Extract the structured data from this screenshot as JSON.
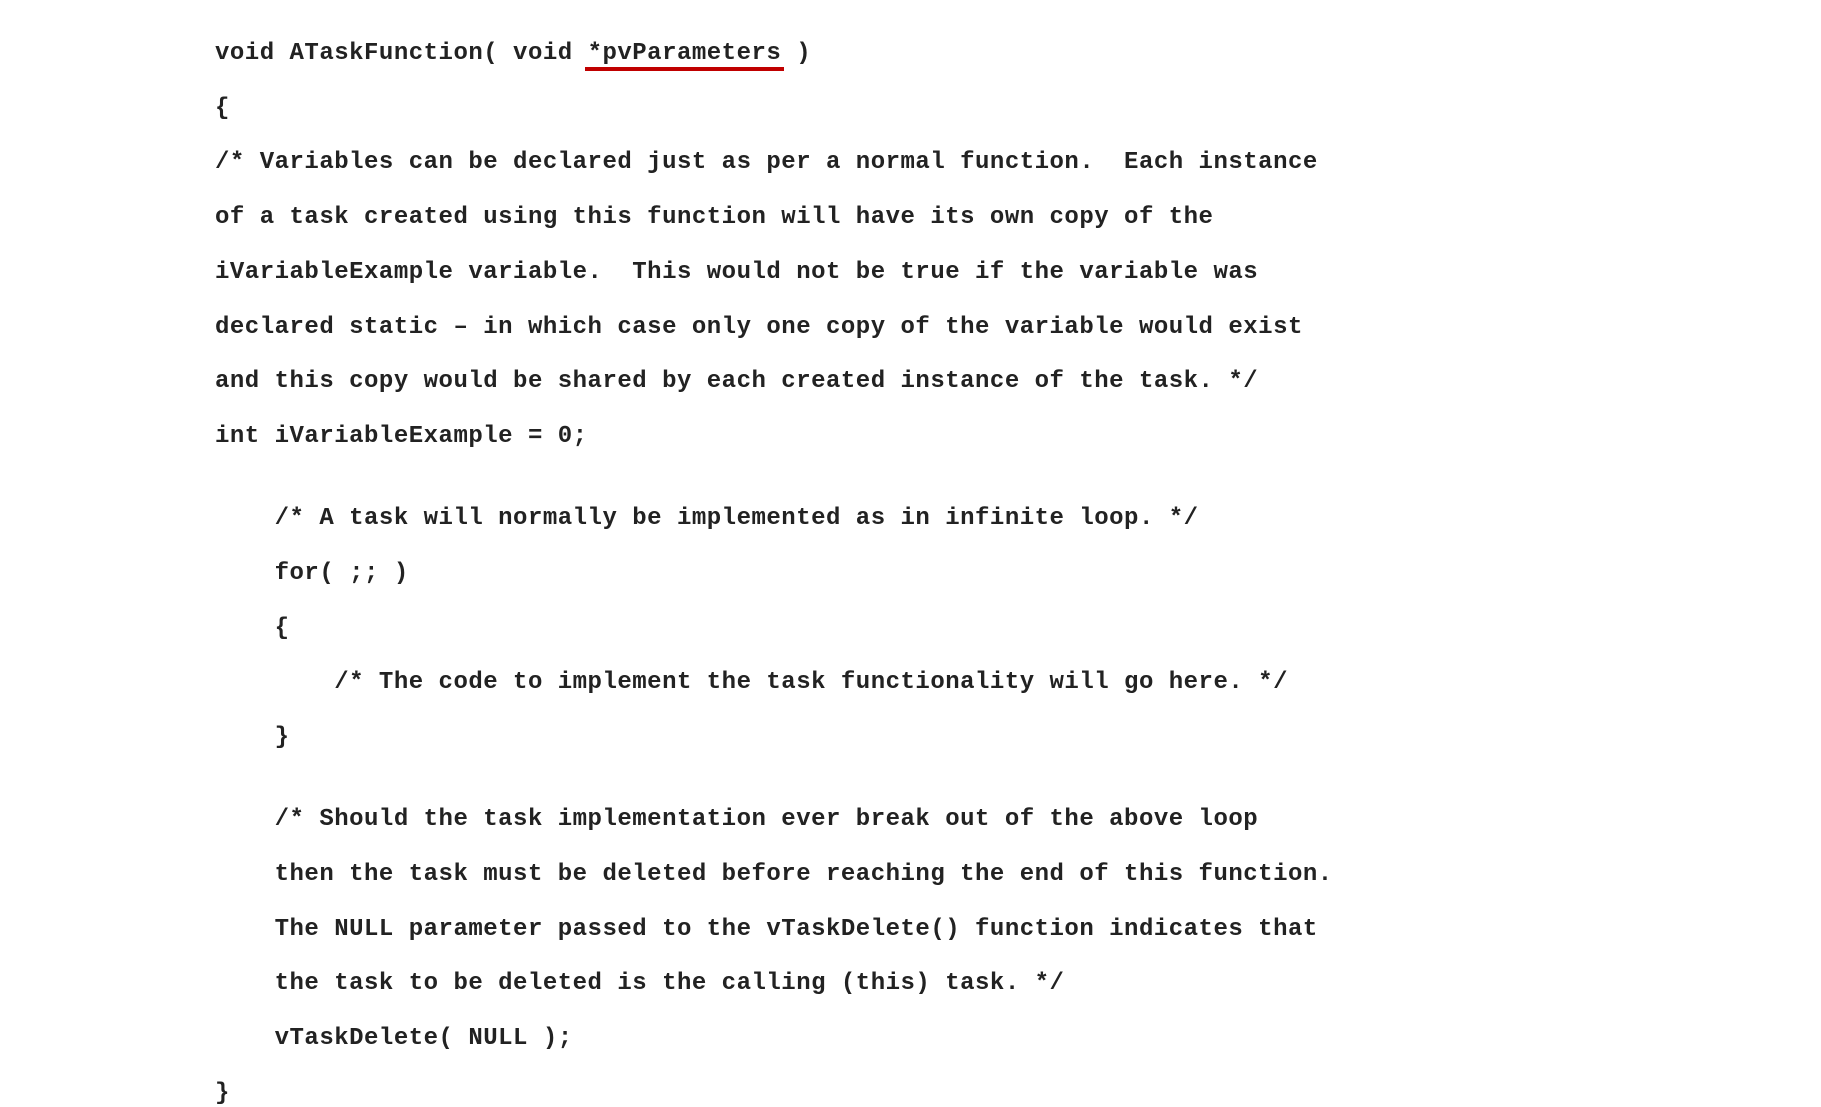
{
  "code": {
    "line01a": "void ATaskFunction( void ",
    "line01b": "*pvParameters",
    "line01c": " )",
    "line02": "{",
    "line03": "/* Variables can be declared just as per a normal function.  Each instance",
    "line04": "of a task created using this function will have its own copy of the",
    "line05": "iVariableExample variable.  This would not be true if the variable was",
    "line06": "declared static – in which case only one copy of the variable would exist",
    "line07": "and this copy would be shared by each created instance of the task. */",
    "line08": "int iVariableExample = 0;",
    "line09": "",
    "line10": "    /* A task will normally be implemented as in infinite loop. */",
    "line11": "    for( ;; )",
    "line12": "    {",
    "line13": "        /* The code to implement the task functionality will go here. */",
    "line14": "    }",
    "line15": "",
    "line16": "    /* Should the task implementation ever break out of the above loop",
    "line17": "    then the task must be deleted before reaching the end of this function.",
    "line18": "    The NULL parameter passed to the vTaskDelete() function indicates that",
    "line19": "    the task to be deleted is the calling (this) task. */",
    "line20": "    vTaskDelete( NULL );",
    "line21": "}"
  }
}
